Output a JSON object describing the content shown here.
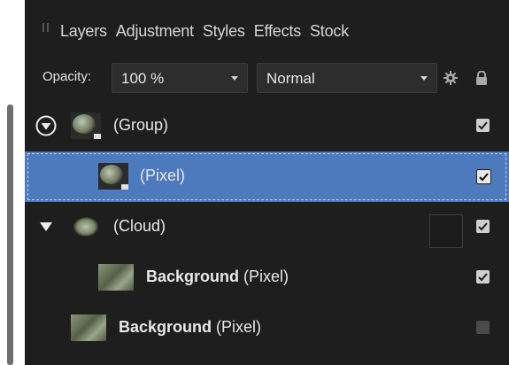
{
  "tabs": [
    "Layers",
    "Adjustment",
    "Styles",
    "Effects",
    "Stock"
  ],
  "toolbar": {
    "opacity_label": "Opacity:",
    "opacity_value": "100 %",
    "blend_mode": "Normal"
  },
  "layers": [
    {
      "name": "(Group)",
      "visible": true,
      "expanded": true,
      "selected": false
    },
    {
      "name": "(Pixel)",
      "visible": true,
      "selected": true
    },
    {
      "name": "(Cloud)",
      "visible": true,
      "expanded": true,
      "selected": false
    },
    {
      "bold": "Background",
      "rest": " (Pixel)",
      "visible": true,
      "selected": false
    },
    {
      "bold": "Background",
      "rest": " (Pixel)",
      "visible": false,
      "selected": false
    }
  ],
  "colors": {
    "panel_bg": "#1e1e1e",
    "selected_row": "#4d79bd",
    "text": "#e8e8e8",
    "checkbox_on": "#cfcfcf"
  }
}
